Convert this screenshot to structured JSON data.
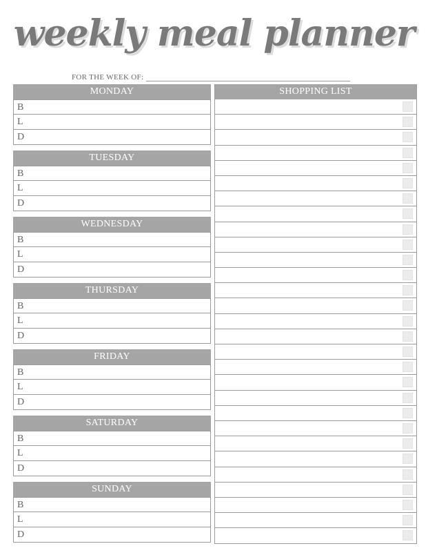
{
  "title": "weekly meal planner",
  "week_label": "FOR THE WEEK OF:",
  "days": [
    {
      "name": "MONDAY"
    },
    {
      "name": "TUESDAY"
    },
    {
      "name": "WEDNESDAY"
    },
    {
      "name": "THURSDAY"
    },
    {
      "name": "FRIDAY"
    },
    {
      "name": "SATURDAY"
    },
    {
      "name": "SUNDAY"
    }
  ],
  "meals": [
    "B",
    "L",
    "D"
  ],
  "shopping": {
    "title": "SHOPPING LIST",
    "item_count": 29
  }
}
